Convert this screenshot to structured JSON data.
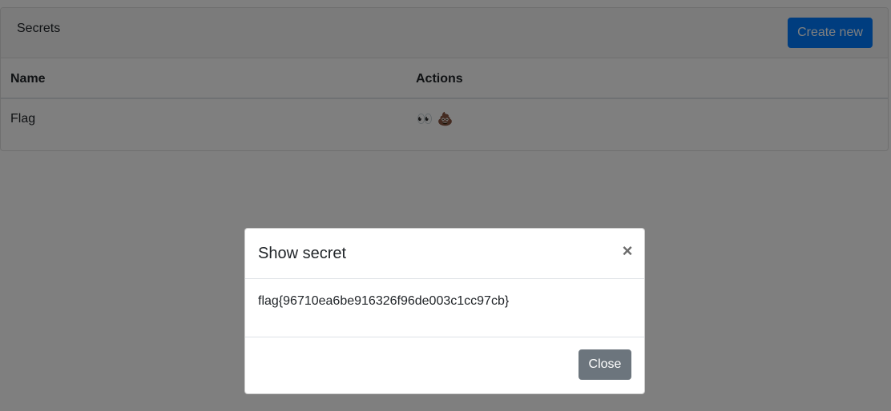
{
  "card": {
    "title": "Secrets",
    "create_button_label": "Create new"
  },
  "table": {
    "headers": [
      "Name",
      "Actions"
    ],
    "rows": [
      {
        "name": "Flag",
        "actions": [
          {
            "icon": "eyes-icon",
            "glyph": "👀"
          },
          {
            "icon": "poop-icon",
            "glyph": "💩"
          }
        ]
      }
    ]
  },
  "modal": {
    "title": "Show secret",
    "close_glyph": "×",
    "secret_value": "flag{96710ea6be916326f96de003c1cc97cb}",
    "close_button_label": "Close"
  },
  "colors": {
    "primary": "#007bff",
    "secondary": "#6c757d",
    "backdrop": "rgba(0,0,0,0.5)"
  }
}
